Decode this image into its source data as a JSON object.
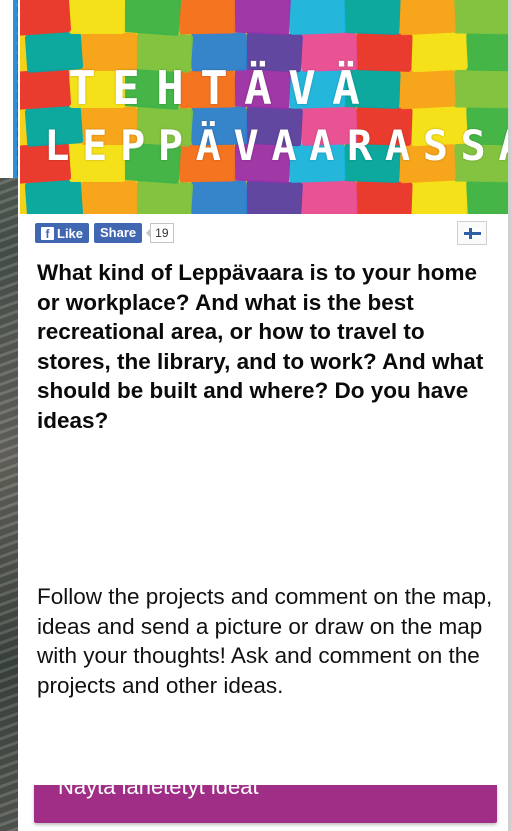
{
  "banner": {
    "line1": [
      "T",
      "E",
      "H",
      "T",
      "Ä",
      "V",
      "Ä"
    ],
    "line2": [
      "L",
      "E",
      "P",
      "P",
      "Ä",
      "V",
      "A",
      "A",
      "R",
      "A",
      "S",
      "S",
      "A"
    ]
  },
  "social": {
    "like_label": "Like",
    "share_label": "Share",
    "count": "19",
    "language_flag": "finland-flag-icon"
  },
  "heading": "What kind of Leppävaara is to your home or workplace? And what is the best recreational area, or how to travel to stores, the library, and to work? And what should be built and where? Do you have ideas?",
  "body": "Follow the projects and comment on the map, ideas and send a picture or draw on the map with your thoughts! Ask and comment on the projects and other ideas.",
  "cta_label": "Näytä lähetetyt ideat",
  "colors": {
    "facebook_blue": "#4267b2",
    "cta_purple": "#a02e86",
    "accent_blue": "#2f8fd8"
  }
}
